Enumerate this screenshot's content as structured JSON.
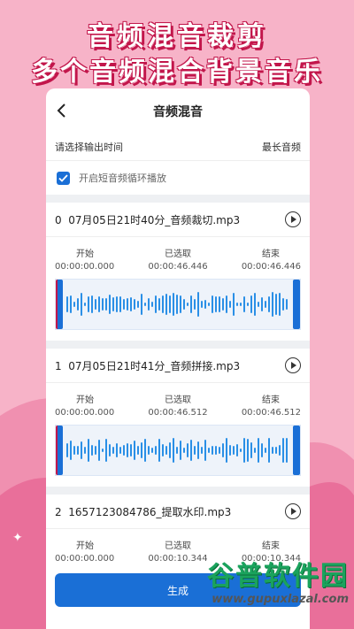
{
  "promo": {
    "line1": "音频混音裁剪",
    "line2": "多个音频混合背景音乐"
  },
  "topbar": {
    "title": "音频混音",
    "back_icon": "back-chevron-icon"
  },
  "output": {
    "label": "请选择输出时间",
    "value": "最长音频"
  },
  "loop": {
    "label": "开启短音频循环播放",
    "checked": true
  },
  "columns": {
    "start": "开始",
    "selected": "已选取",
    "end": "结束"
  },
  "tracks": [
    {
      "index": "0",
      "filename": "07月05日21时40分_音频裁切.mp3",
      "start": "00:00:00.000",
      "selected": "00:00:46.446",
      "end": "00:00:46.446"
    },
    {
      "index": "1",
      "filename": "07月05日21时41分_音频拼接.mp3",
      "start": "00:00:00.000",
      "selected": "00:00:46.512",
      "end": "00:00:46.512"
    },
    {
      "index": "2",
      "filename": "1657123084786_提取水印.mp3",
      "start": "00:00:00.000",
      "selected": "00:00:10.344",
      "end": "00:00:10.344"
    }
  ],
  "generate_label": "生成",
  "watermark": {
    "logo": "谷普软件园",
    "url": "www.gupuxlazal.com"
  },
  "colors": {
    "accent": "#1a6fd6",
    "wave": "#2a8fe6",
    "background": "#f7b3c8",
    "title_outline": "#c2164b"
  }
}
